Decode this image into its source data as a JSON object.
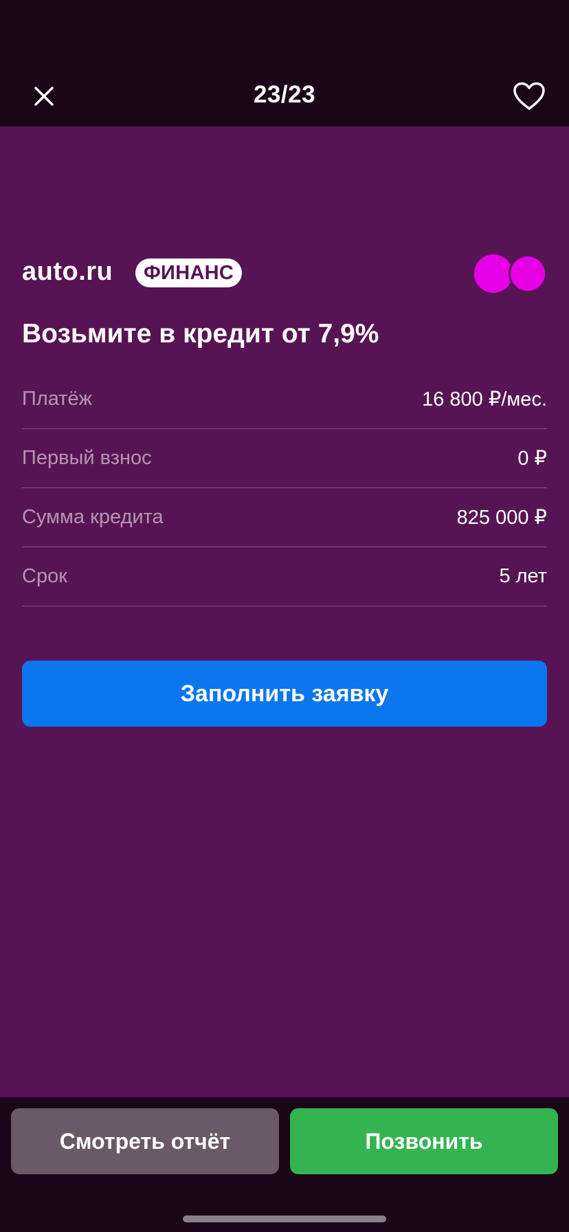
{
  "header": {
    "counter": "23/23",
    "close_icon": "close-icon",
    "favorite_icon": "heart-outline-icon"
  },
  "promo": {
    "brand_name": "auto.ru",
    "brand_badge": "ФИНАНС",
    "headline": "Возьмите в кредит от 7,9%",
    "rows": [
      {
        "label": "Платёж",
        "value": "16 800 ₽/мес."
      },
      {
        "label": "Первый взнос",
        "value": "0 ₽"
      },
      {
        "label": "Сумма кредита",
        "value": "825 000 ₽"
      },
      {
        "label": "Срок",
        "value": "5 лет"
      }
    ],
    "apply_label": "Заполнить заявку"
  },
  "footer": {
    "report_label": "Смотреть отчёт",
    "call_label": "Позвонить"
  },
  "colors": {
    "background_dark": "#1a0519",
    "panel_purple": "#571455",
    "accent_magenta": "#e600e6",
    "apply_blue": "#0c76ee",
    "report_gray": "#6a5967",
    "call_green": "#34b451"
  }
}
